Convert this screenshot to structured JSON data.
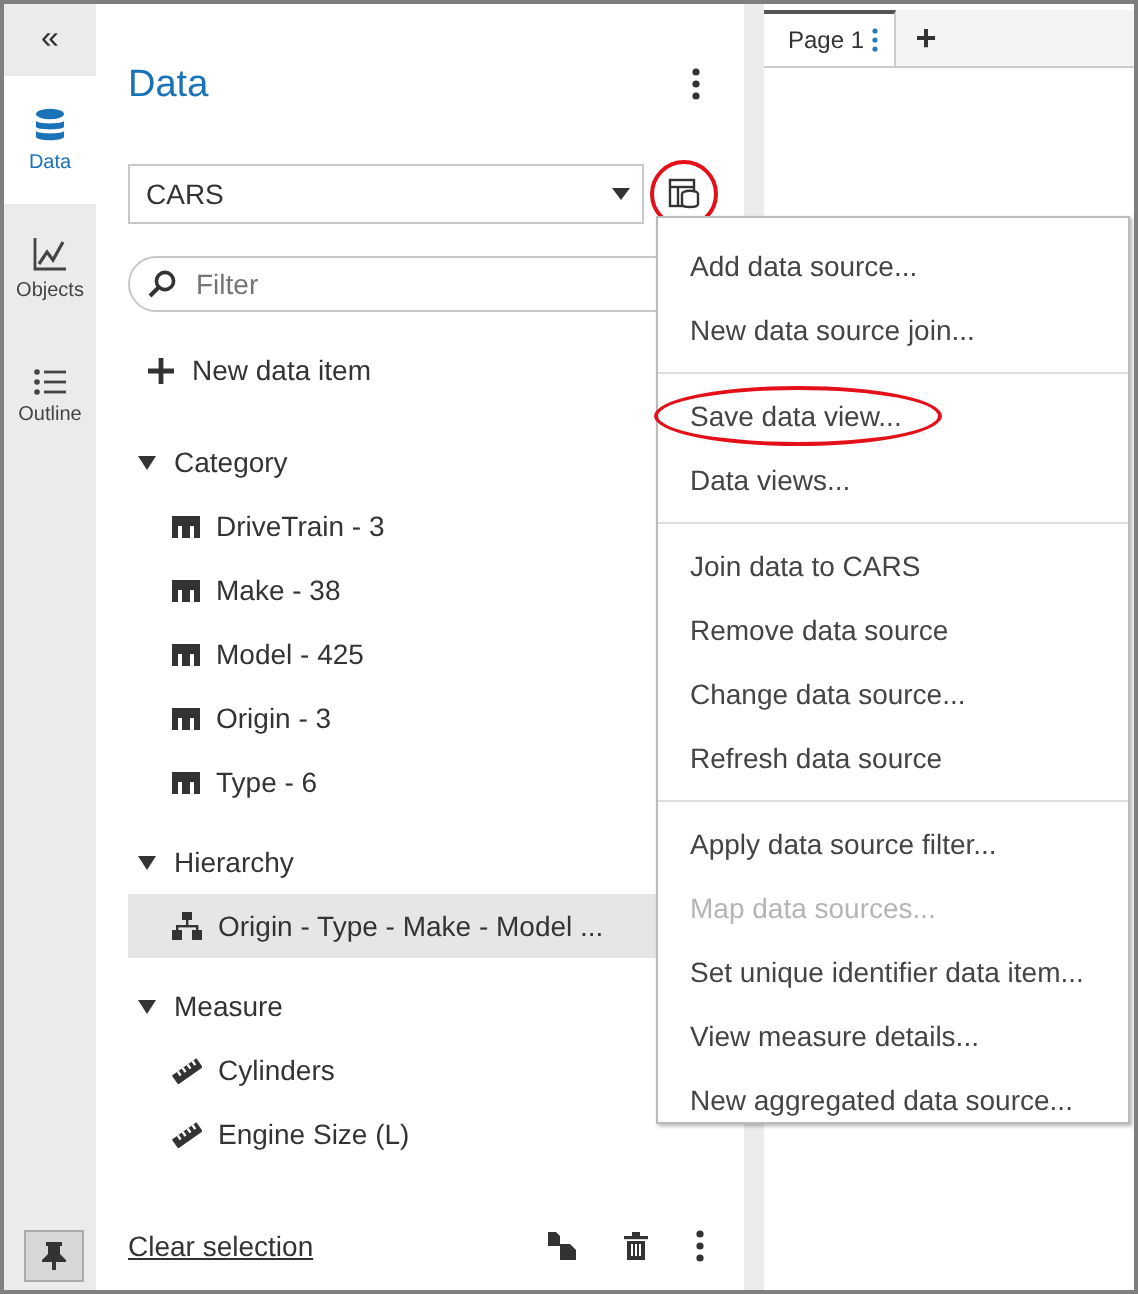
{
  "rail": {
    "collapse": "«",
    "tabs": [
      {
        "label": "Data",
        "kind": "data",
        "selected": true
      },
      {
        "label": "Objects",
        "kind": "objects",
        "selected": false
      },
      {
        "label": "Outline",
        "kind": "outline",
        "selected": false
      }
    ]
  },
  "panel": {
    "title": "Data",
    "source": {
      "value": "CARS",
      "highlighted": true
    },
    "filter": {
      "placeholder": "Filter"
    },
    "new_item": "New data item",
    "groups": [
      {
        "label": "Category",
        "expanded": true,
        "children": [
          {
            "label": "DriveTrain - 3",
            "kind": "category",
            "selected": false
          },
          {
            "label": "Make - 38",
            "kind": "category",
            "selected": false
          },
          {
            "label": "Model - 425",
            "kind": "category",
            "selected": false
          },
          {
            "label": "Origin - 3",
            "kind": "category",
            "selected": false
          },
          {
            "label": "Type - 6",
            "kind": "category",
            "selected": false
          }
        ]
      },
      {
        "label": "Hierarchy",
        "expanded": true,
        "children": [
          {
            "label": "Origin - Type - Make - Model ...",
            "kind": "hierarchy",
            "selected": true
          }
        ]
      },
      {
        "label": "Measure",
        "expanded": true,
        "children": [
          {
            "label": "Cylinders",
            "kind": "measure",
            "selected": false
          },
          {
            "label": "Engine Size (L)",
            "kind": "measure",
            "selected": false
          }
        ]
      }
    ],
    "footer": {
      "link": "Clear selection"
    }
  },
  "page_tabs": [
    {
      "label": "Page 1",
      "selected": true
    }
  ],
  "add_page": "+",
  "menu": {
    "sections": [
      [
        {
          "label": "Add data source...",
          "disabled": false,
          "highlighted": false
        },
        {
          "label": "New data source join...",
          "disabled": false,
          "highlighted": false
        }
      ],
      [
        {
          "label": "Save data view...",
          "disabled": false,
          "highlighted": true
        },
        {
          "label": "Data views...",
          "disabled": false,
          "highlighted": false
        }
      ],
      [
        {
          "label": "Join data to CARS",
          "disabled": false,
          "highlighted": false
        },
        {
          "label": "Remove data source",
          "disabled": false,
          "highlighted": false
        },
        {
          "label": "Change data source...",
          "disabled": false,
          "highlighted": false
        },
        {
          "label": "Refresh data source",
          "disabled": false,
          "highlighted": false
        }
      ],
      [
        {
          "label": "Apply data source filter...",
          "disabled": false,
          "highlighted": false
        },
        {
          "label": "Map data sources...",
          "disabled": true,
          "highlighted": false
        },
        {
          "label": "Set unique identifier data item...",
          "disabled": false,
          "highlighted": false
        },
        {
          "label": "View measure details...",
          "disabled": false,
          "highlighted": false
        },
        {
          "label": "New aggregated data source...",
          "disabled": false,
          "highlighted": false
        }
      ]
    ]
  }
}
